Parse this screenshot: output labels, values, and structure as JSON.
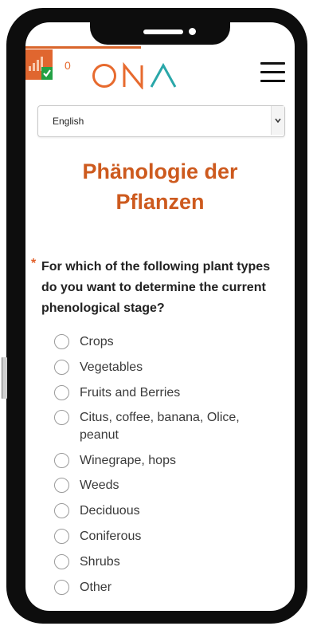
{
  "header": {
    "count": "0",
    "logo_text": "ONA",
    "colors": {
      "orange": "#e76a2e",
      "check_green": "#23a044",
      "badge_bg": "#e0662f"
    }
  },
  "language_select": {
    "value": "English"
  },
  "title": {
    "line1": "Phänologie der",
    "line2": "Pflanzen"
  },
  "question": {
    "required_marker": "*",
    "text": "For which of the following plant types do you want to determine the current phenological stage?"
  },
  "options": [
    "Crops",
    "Vegetables",
    "Fruits and Berries",
    "Citus, coffee, banana, Olice, peanut",
    "Winegrape, hops",
    "Weeds",
    "Deciduous",
    "Coniferous",
    "Shrubs",
    "Other"
  ]
}
